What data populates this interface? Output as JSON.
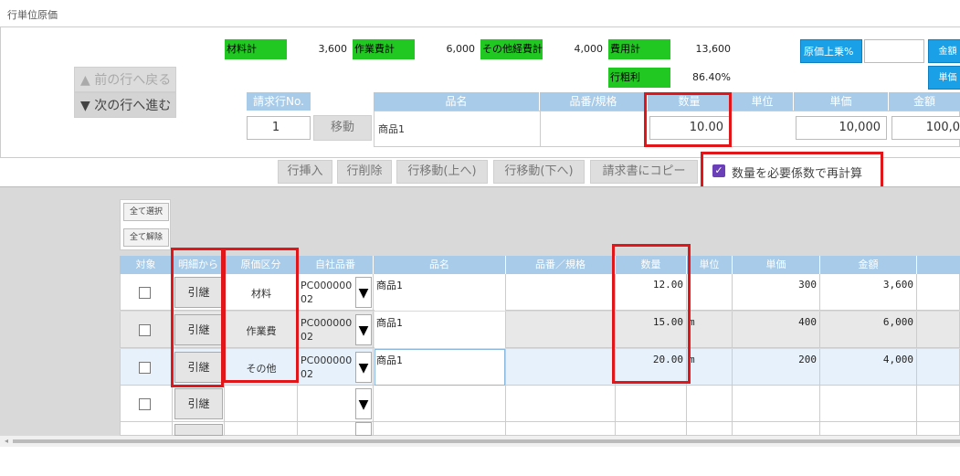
{
  "page_title": "行単位原価",
  "summary": {
    "material_total_label": "材料計",
    "material_total_value": "3,600",
    "work_total_label": "作業費計",
    "work_total_value": "6,000",
    "other_total_label": "その他経費計",
    "other_total_value": "4,000",
    "cost_total_label": "費用計",
    "cost_total_value": "13,600",
    "gross_margin_label": "行粗利",
    "gross_margin_value": "86.40%",
    "markup_label": "原価上乗%",
    "markup_value": "",
    "amount_btn_label": "金額",
    "unit_price_btn_label": "単価"
  },
  "nav": {
    "prev_label": "▲ 前の行へ戻る",
    "next_label": "▼ 次の行へ進む"
  },
  "invoice_line": {
    "header_no": "請求行No.",
    "no_value": "1",
    "move_label": "移動",
    "header_name": "品名",
    "header_code": "品番/規格",
    "header_qty": "数量",
    "header_unit": "単位",
    "header_price": "単価",
    "header_amount": "金額",
    "name": "商品1",
    "code": "",
    "qty": "10.00",
    "unit": "",
    "price": "10,000",
    "amount": "100,0"
  },
  "toolbar": {
    "insert": "行挿入",
    "delete": "行削除",
    "move_up": "行移動(上へ)",
    "move_down": "行移動(下へ)",
    "copy_to_invoice": "請求書にコピー",
    "recalc_label": "数量を必要係数で再計算",
    "recalc_checked": true
  },
  "grid": {
    "select_all": "全て選択",
    "deselect_all": "全て解除",
    "headers": [
      "対象",
      "明細から",
      "原価区分",
      "自社品番",
      "品名",
      "品番／規格",
      "数量",
      "単位",
      "単価",
      "金額"
    ],
    "inherit_label": "引継",
    "rows": [
      {
        "category": "材料",
        "item_code": "PC00000002",
        "name": "商品1",
        "spec": "",
        "qty": "12.00",
        "unit": "",
        "price": "300",
        "amount": "3,600"
      },
      {
        "category": "作業費",
        "item_code": "PC00000002",
        "name": "商品1",
        "spec": "",
        "qty": "15.00",
        "unit": "m",
        "price": "400",
        "amount": "6,000"
      },
      {
        "category": "その他",
        "item_code": "PC00000002",
        "name": "商品1",
        "spec": "",
        "qty": "20.00",
        "unit": "m",
        "price": "200",
        "amount": "4,000"
      },
      {
        "category": "",
        "item_code": "",
        "name": "",
        "spec": "",
        "qty": "",
        "unit": "",
        "price": "",
        "amount": ""
      }
    ]
  },
  "colors": {
    "green": "#22c822",
    "blue": "#1aa0e6",
    "header_blue": "#a7cbe8",
    "highlight_red": "#e0161b"
  }
}
